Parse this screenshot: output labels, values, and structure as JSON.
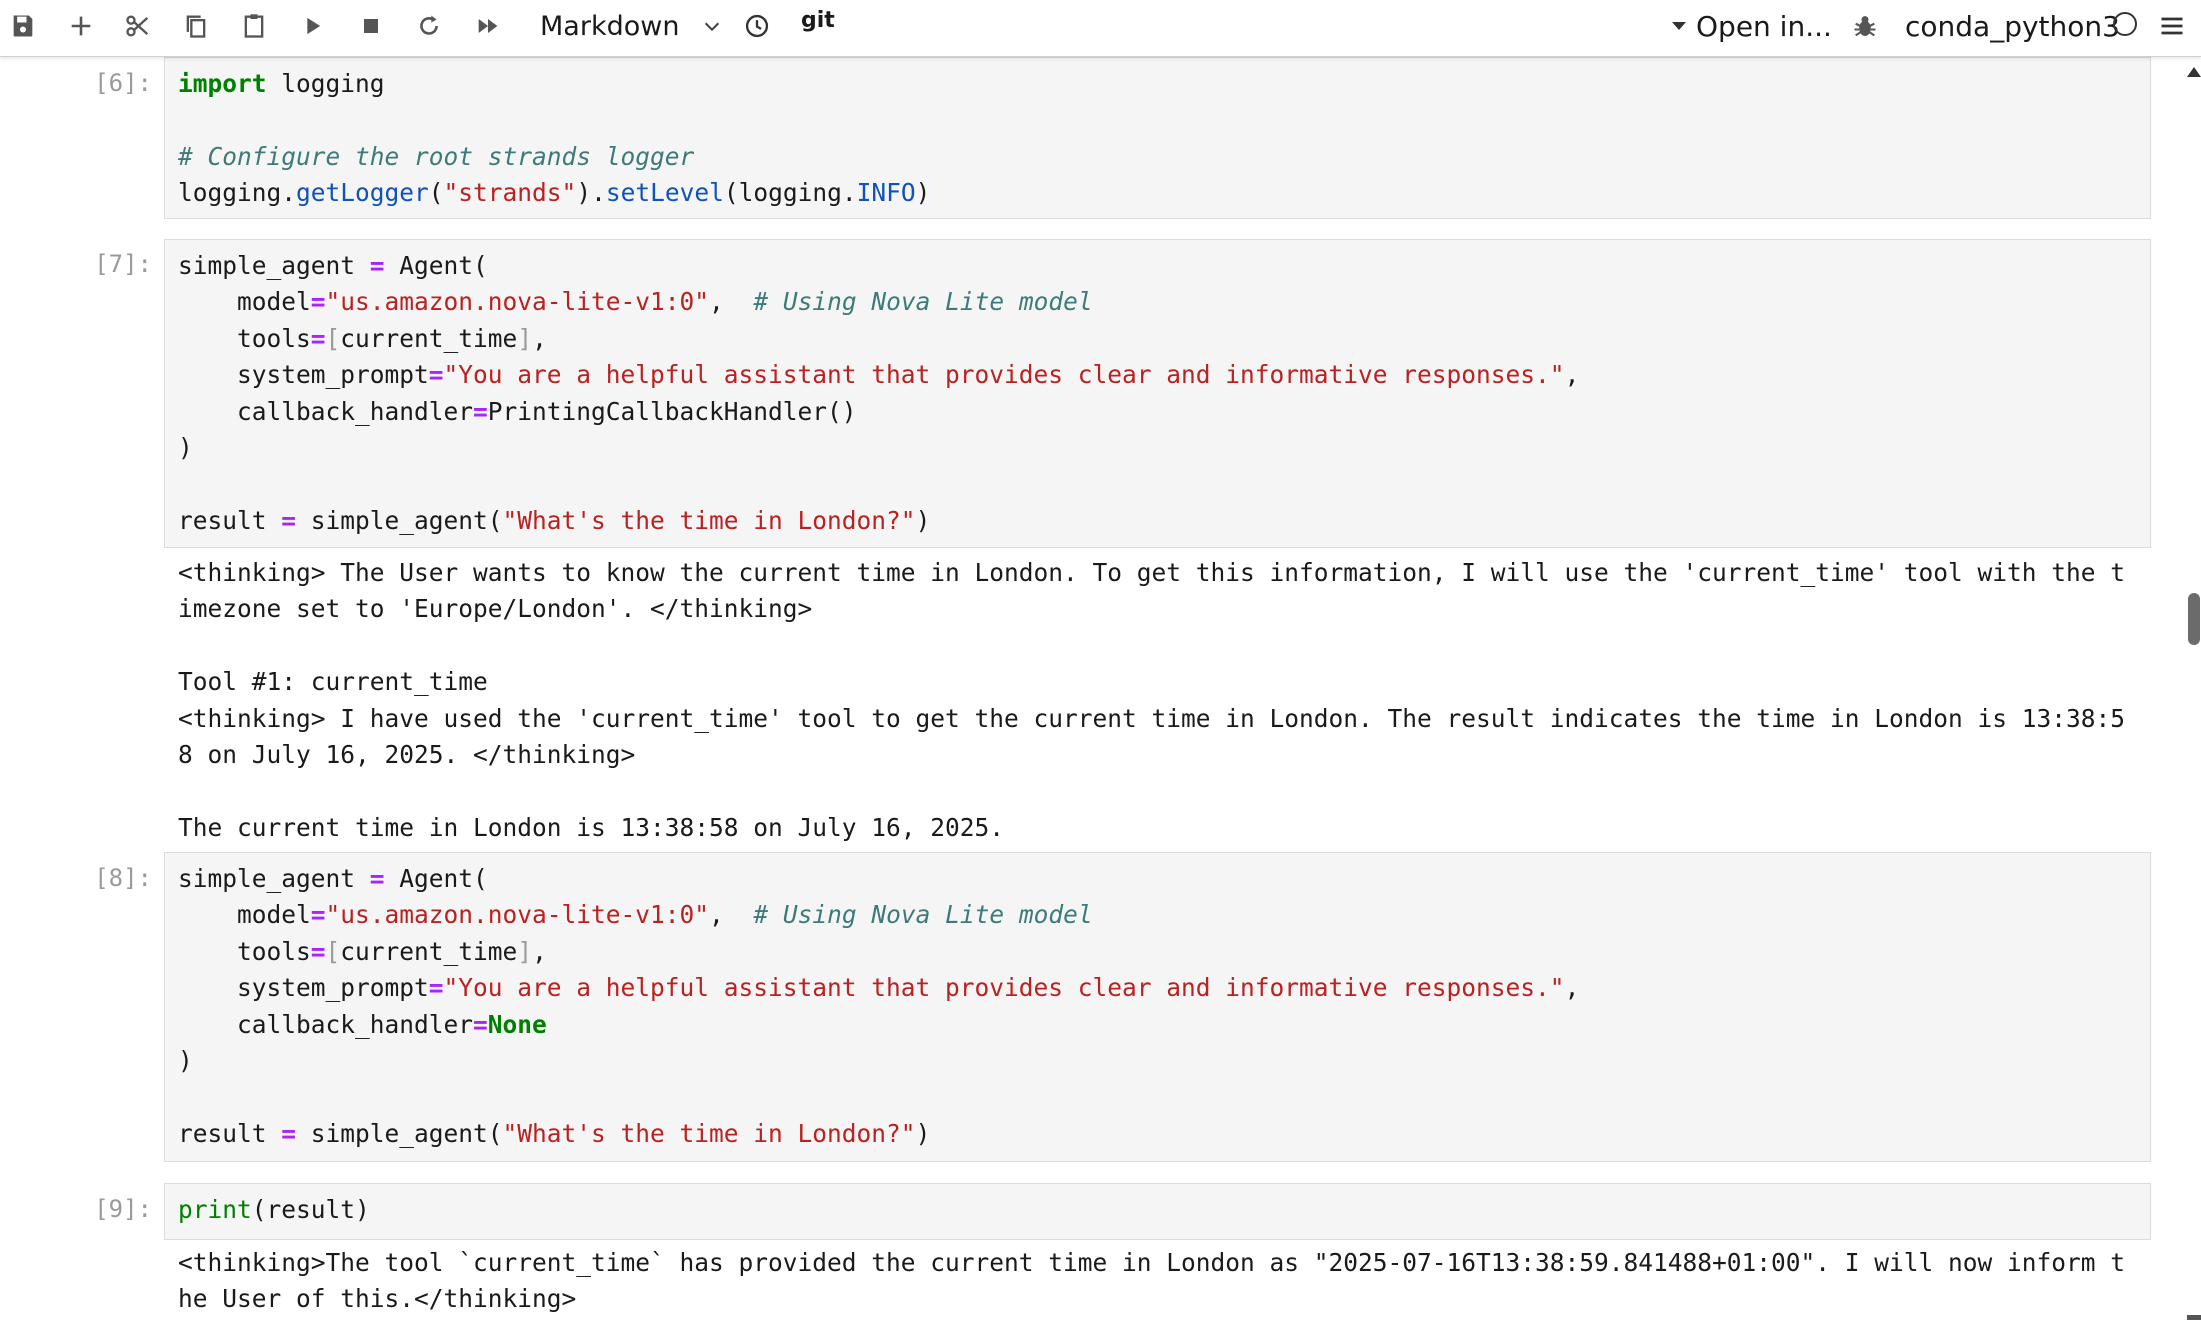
{
  "toolbar": {
    "cell_type": "Markdown",
    "git_label": "git",
    "open_in_label": "Open in...",
    "kernel_name": "conda_python3",
    "icons": [
      "save-icon",
      "add-cell-icon",
      "cut-icon",
      "copy-icon",
      "paste-icon",
      "run-icon",
      "stop-icon",
      "restart-icon",
      "run-all-icon",
      "chevron-down-icon",
      "clock-icon",
      "git-icon",
      "bug-icon",
      "kernel-idle-icon",
      "menu-icon"
    ]
  },
  "cells": [
    {
      "prompt": "[6]:",
      "code": [
        [
          [
            "kw",
            "import"
          ],
          [
            "t",
            " logging"
          ]
        ],
        [],
        [
          [
            "com",
            "# Configure the root strands logger"
          ]
        ],
        [
          [
            "t",
            "logging."
          ],
          [
            "fn",
            "getLogger"
          ],
          [
            "t",
            "("
          ],
          [
            "str",
            "\"strands\""
          ],
          [
            "t",
            ")."
          ],
          [
            "fn",
            "setLevel"
          ],
          [
            "t",
            "(logging."
          ],
          [
            "fn",
            "INFO"
          ],
          [
            "t",
            ")"
          ]
        ]
      ]
    },
    {
      "prompt": "[7]:",
      "code": [
        [
          [
            "t",
            "simple_agent "
          ],
          [
            "op",
            "="
          ],
          [
            "t",
            " Agent("
          ]
        ],
        [
          [
            "t",
            "    model"
          ],
          [
            "op",
            "="
          ],
          [
            "str",
            "\"us.amazon.nova-lite-v1:0\""
          ],
          [
            "t",
            ",  "
          ],
          [
            "com",
            "# Using Nova Lite model"
          ]
        ],
        [
          [
            "t",
            "    tools"
          ],
          [
            "op",
            "="
          ],
          [
            "br",
            "["
          ],
          [
            "t",
            "current_time"
          ],
          [
            "br",
            "]"
          ],
          [
            "t",
            ","
          ]
        ],
        [
          [
            "t",
            "    system_prompt"
          ],
          [
            "op",
            "="
          ],
          [
            "str",
            "\"You are a helpful assistant that provides clear and informative responses.\""
          ],
          [
            "t",
            ","
          ]
        ],
        [
          [
            "t",
            "    callback_handler"
          ],
          [
            "op",
            "="
          ],
          [
            "t",
            "PrintingCallbackHandler()"
          ]
        ],
        [
          [
            "t",
            ")"
          ]
        ],
        [],
        [
          [
            "t",
            "result "
          ],
          [
            "op",
            "="
          ],
          [
            "t",
            " simple_agent("
          ],
          [
            "str",
            "\"What's the time in London?\""
          ],
          [
            "t",
            ")"
          ]
        ]
      ],
      "output": "<thinking> The User wants to know the current time in London. To get this information, I will use the 'current_time' tool with the timezone set to 'Europe/London'. </thinking>\n\nTool #1: current_time\n<thinking> I have used the 'current_time' tool to get the current time in London. The result indicates the time in London is 13:38:58 on July 16, 2025. </thinking>\n\nThe current time in London is 13:38:58 on July 16, 2025."
    },
    {
      "prompt": "[8]:",
      "code": [
        [
          [
            "t",
            "simple_agent "
          ],
          [
            "op",
            "="
          ],
          [
            "t",
            " Agent("
          ]
        ],
        [
          [
            "t",
            "    model"
          ],
          [
            "op",
            "="
          ],
          [
            "str",
            "\"us.amazon.nova-lite-v1:0\""
          ],
          [
            "t",
            ",  "
          ],
          [
            "com",
            "# Using Nova Lite model"
          ]
        ],
        [
          [
            "t",
            "    tools"
          ],
          [
            "op",
            "="
          ],
          [
            "br",
            "["
          ],
          [
            "t",
            "current_time"
          ],
          [
            "br",
            "]"
          ],
          [
            "t",
            ","
          ]
        ],
        [
          [
            "t",
            "    system_prompt"
          ],
          [
            "op",
            "="
          ],
          [
            "str",
            "\"You are a helpful assistant that provides clear and informative responses.\""
          ],
          [
            "t",
            ","
          ]
        ],
        [
          [
            "t",
            "    callback_handler"
          ],
          [
            "op",
            "="
          ],
          [
            "kw",
            "None"
          ]
        ],
        [
          [
            "t",
            ")"
          ]
        ],
        [],
        [
          [
            "t",
            "result "
          ],
          [
            "op",
            "="
          ],
          [
            "t",
            " simple_agent("
          ],
          [
            "str",
            "\"What's the time in London?\""
          ],
          [
            "t",
            ")"
          ]
        ]
      ]
    },
    {
      "prompt": "[9]:",
      "code": [
        [
          [
            "bi",
            "print"
          ],
          [
            "t",
            "(result)"
          ]
        ]
      ],
      "output": "<thinking>The tool `current_time` has provided the current time in London as \"2025-07-16T13:38:59.841488+01:00\". I will now inform the User of this.</thinking>"
    }
  ]
}
